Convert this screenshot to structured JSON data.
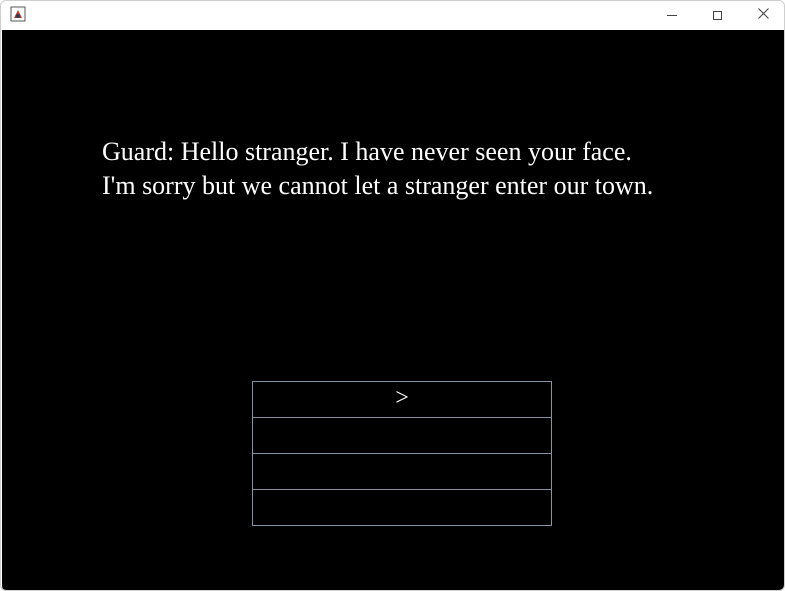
{
  "window": {
    "icon": "java-app-icon",
    "controls": [
      "minimize-icon",
      "maximize-icon",
      "close-icon"
    ]
  },
  "dialogue": {
    "lines": [
      "Guard: Hello stranger. I have never seen your face.",
      "I'm sorry but we cannot let a stranger enter our town."
    ]
  },
  "choices": [
    {
      "label": ">"
    },
    {
      "label": ""
    },
    {
      "label": ""
    },
    {
      "label": ""
    }
  ],
  "colors": {
    "background": "#000000",
    "text": "#ffffff",
    "choice_border": "#8a93a6"
  }
}
